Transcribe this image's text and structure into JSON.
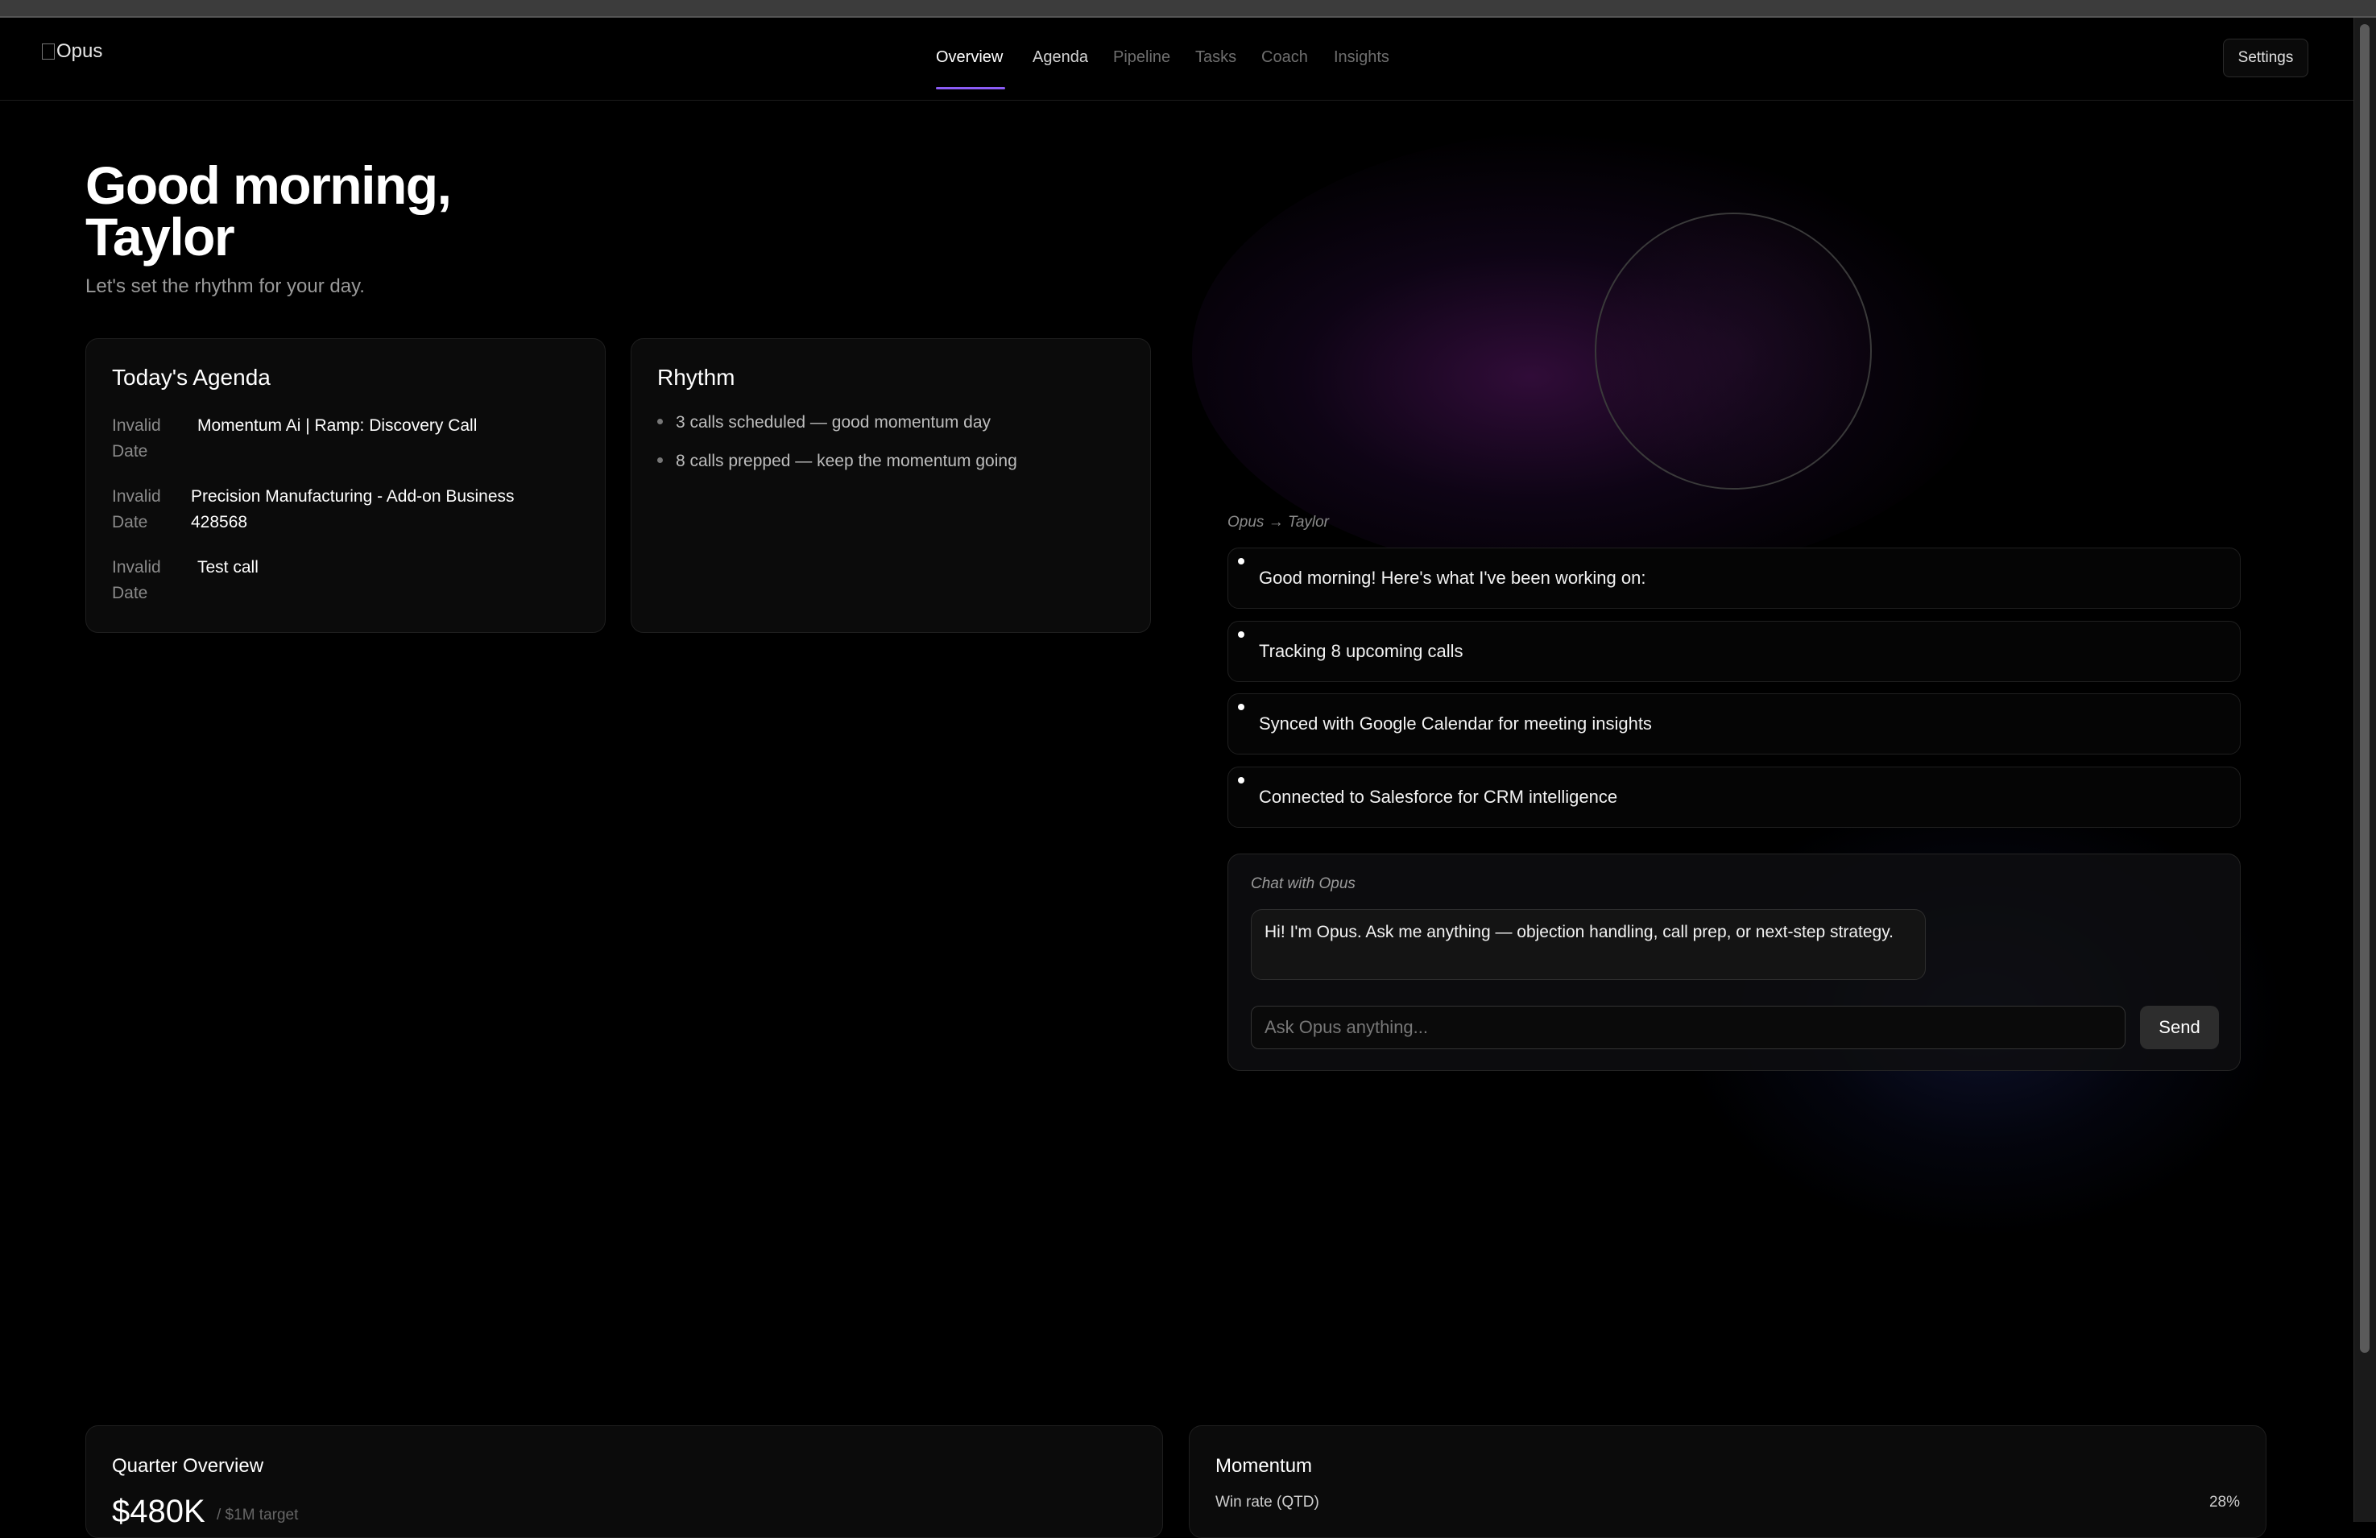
{
  "header": {
    "logo_alt": "Opus",
    "nav": [
      {
        "label": "Overview",
        "state": "active"
      },
      {
        "label": "Agenda",
        "state": "enabled"
      },
      {
        "label": "Pipeline",
        "state": "dim"
      },
      {
        "label": "Tasks",
        "state": "dim"
      },
      {
        "label": "Coach",
        "state": "dim"
      },
      {
        "label": "Insights",
        "state": "dim"
      }
    ],
    "settings_label": "Settings"
  },
  "hero": {
    "greeting_line1": "Good morning,",
    "greeting_line2": "Taylor",
    "subtitle": "Let's set the rhythm for your day."
  },
  "agenda": {
    "title": "Today's Agenda",
    "items": [
      {
        "date": "Invalid Date",
        "title": "Momentum Ai | Ramp: Discovery Call"
      },
      {
        "date": "Invalid Date",
        "title": "Precision Manufacturing - Add-on Business 428568"
      },
      {
        "date": "Invalid Date",
        "title": "Test call"
      }
    ]
  },
  "rhythm": {
    "title": "Rhythm",
    "items": [
      "3 calls scheduled — good momentum day",
      "8 calls prepped — keep the momentum going"
    ]
  },
  "feed": {
    "label": "Opus → Taylor",
    "items": [
      "Good morning! Here's what I've been working on:",
      "Tracking 8 upcoming calls",
      "Synced with Google Calendar for meeting insights",
      "Connected to Salesforce for CRM intelligence"
    ]
  },
  "chat": {
    "label": "Chat with Opus",
    "message": "Hi! I'm Opus. Ask me anything — objection handling, call prep, or next-step strategy.",
    "input_placeholder": "Ask Opus anything...",
    "send_label": "Send"
  },
  "quarter": {
    "title": "Quarter Overview",
    "value": "$480K",
    "target": "/ $1M target"
  },
  "momentum": {
    "title": "Momentum",
    "win_rate_label": "Win rate (QTD)",
    "win_rate_value": "28%"
  },
  "colors": {
    "background": "#000000",
    "accent": "#8b5cf6",
    "card": "#0b0b0b"
  }
}
